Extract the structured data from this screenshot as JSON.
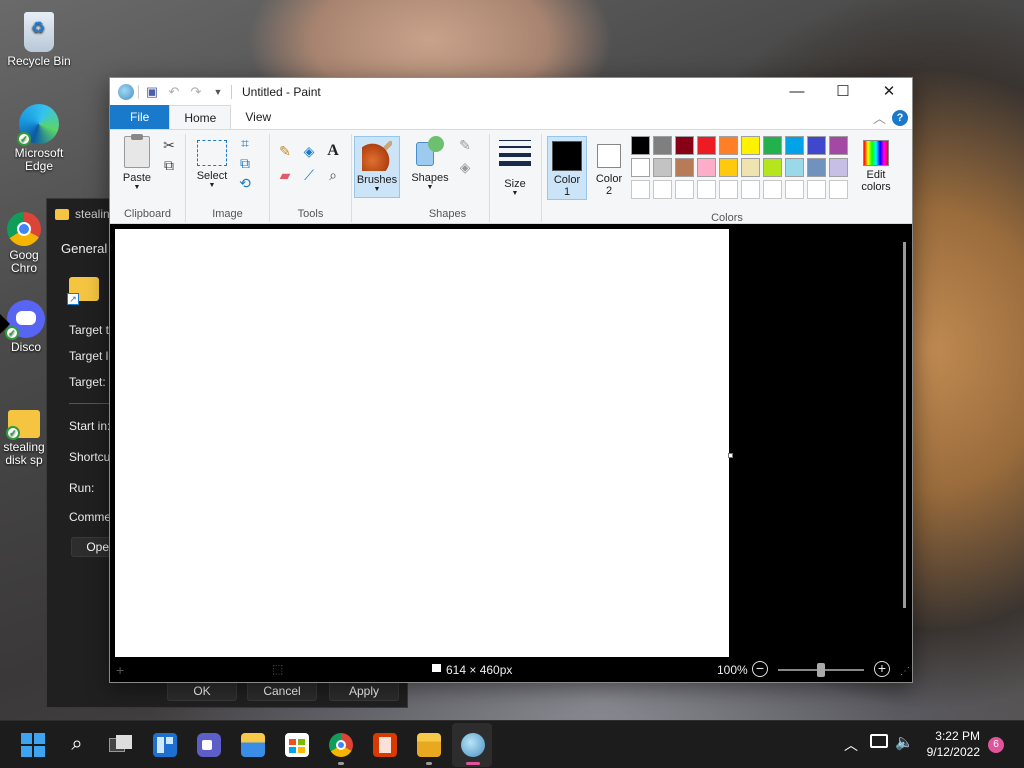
{
  "desktop": {
    "icons": [
      {
        "label": "Recycle Bin"
      },
      {
        "label": "Microsoft Edge"
      },
      {
        "label": "Google Chrome",
        "visible_label": "Goog Chro"
      },
      {
        "label": "Disco"
      },
      {
        "label": "stealing disk sp"
      }
    ]
  },
  "properties_dialog": {
    "title": "stealin",
    "tab_general": "General",
    "rows": {
      "target_type": "Target ty",
      "target_location": "Target lo",
      "target": "Target:",
      "start_in": "Start in:",
      "shortcut": "Shortcu",
      "run": "Run:",
      "comment": "Commer",
      "open": "Open"
    },
    "buttons": {
      "ok": "OK",
      "cancel": "Cancel",
      "apply": "Apply"
    }
  },
  "paint": {
    "title": "Untitled - Paint",
    "tabs": {
      "file": "File",
      "home": "Home",
      "view": "View"
    },
    "groups": {
      "clipboard": "Clipboard",
      "image": "Image",
      "tools": "Tools",
      "shapes": "Shapes",
      "colors": "Colors"
    },
    "buttons": {
      "paste": "Paste",
      "select": "Select",
      "brushes": "Brushes",
      "shapes": "Shapes",
      "size": "Size",
      "color1_a": "Color",
      "color1_b": "1",
      "color2_a": "Color",
      "color2_b": "2",
      "edit_colors_a": "Edit",
      "edit_colors_b": "colors"
    },
    "palette_row1": [
      "#000000",
      "#7f7f7f",
      "#880015",
      "#ed1c24",
      "#ff7f27",
      "#fff200",
      "#22b14c",
      "#00a2e8",
      "#3f48cc",
      "#a349a4"
    ],
    "palette_row2": [
      "#ffffff",
      "#c3c3c3",
      "#b97a57",
      "#ffaec9",
      "#ffc90e",
      "#efe4b0",
      "#b5e61d",
      "#99d9ea",
      "#7092be",
      "#c8bfe7"
    ],
    "color1": "#000000",
    "color2": "#ffffff",
    "status": {
      "dimensions": "614 × 460px",
      "zoom": "100%"
    }
  },
  "taskbar": {
    "time": "3:22 PM",
    "date": "9/12/2022",
    "notification_count": "6"
  }
}
